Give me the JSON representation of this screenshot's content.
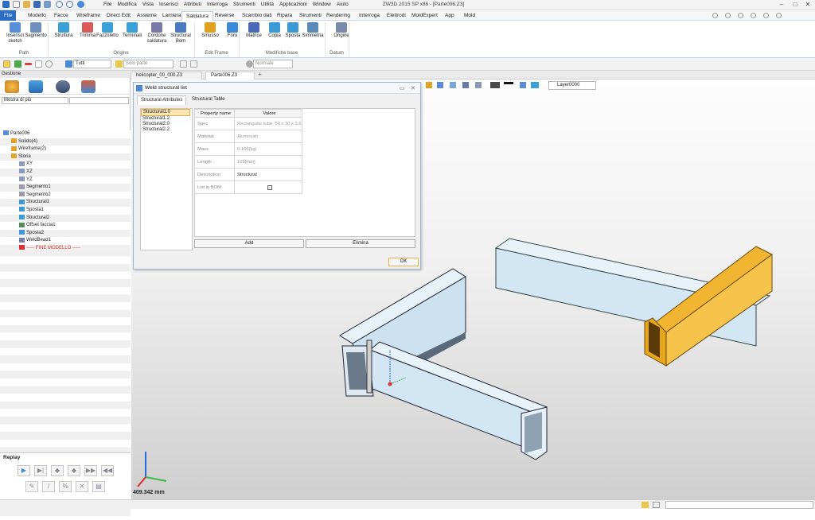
{
  "title_bar": {
    "menu": [
      "File",
      "Modifica",
      "Vista",
      "Inserisci",
      "Attributi",
      "Interroga",
      "Strumenti",
      "Utilità",
      "Applicazioni",
      "Window",
      "Aiuto"
    ],
    "title": "ZW3D 2015 SP x86 - [Parte006.Z3]"
  },
  "ribbon_tabs": [
    "File",
    "Modello",
    "Facce",
    "Wireframe",
    "Direct Edit",
    "Assieme",
    "Lamiera",
    "Saldatura",
    "Reverse",
    "Scambio dati",
    "Ripara",
    "Strumenti",
    "Rendering",
    "Interroga",
    "Elettrodi",
    "MoldExpert",
    "App",
    "Mold"
  ],
  "active_tab": "Saldatura",
  "ribbon": {
    "buttons": [
      {
        "label": "Inserisci\nsketch",
        "color": "#5a8fd8"
      },
      {
        "label": "Segmento",
        "color": "#6f8ebf"
      },
      {
        "label": "Struttura",
        "color": "#3aa0d8"
      },
      {
        "label": "Trimma",
        "color": "#d85a5a"
      },
      {
        "label": "Fazzoletto",
        "color": "#3aa0d8"
      },
      {
        "label": "Terminali",
        "color": "#3aa0d8"
      },
      {
        "label": "Cordone\nsaldatura",
        "color": "#7a7aa8"
      },
      {
        "label": "Structural\nBom",
        "color": "#4a7abf"
      },
      {
        "label": "Smusso",
        "color": "#e0a020"
      },
      {
        "label": "Foro",
        "color": "#3a8ad8"
      },
      {
        "label": "Matrice",
        "color": "#4a6ab8"
      },
      {
        "label": "Copia",
        "color": "#3a9ad8"
      },
      {
        "label": "Sposta",
        "color": "#3a9ad8"
      },
      {
        "label": "Simmetria",
        "color": "#5a8ab8"
      },
      {
        "label": "Origine",
        "color": "#7a8aa8"
      }
    ],
    "groups": [
      "Path",
      "Origine",
      "Edit Frame",
      "Modifiche base",
      "Datum"
    ]
  },
  "toolbar": {
    "filter_value": "Tutti",
    "part_value": "Solo parte",
    "normal_value": "Normale",
    "layer_value": "Layer0000"
  },
  "left_panel": {
    "header": "Gestione",
    "filter_value": "Mostra di più",
    "tree": [
      {
        "label": "Parte006",
        "indent": 0,
        "color": "#5b8ad0"
      },
      {
        "label": "Solido(4)",
        "indent": 1,
        "color": "#e2a22b"
      },
      {
        "label": "Wireframe(2)",
        "indent": 1,
        "color": "#e2a22b"
      },
      {
        "label": "Storia",
        "indent": 1,
        "color": "#e2a22b"
      },
      {
        "label": "XY",
        "indent": 2,
        "color": "#8a9ab8"
      },
      {
        "label": "XZ",
        "indent": 2,
        "color": "#8a9ab8"
      },
      {
        "label": "YZ",
        "indent": 2,
        "color": "#8a9ab8"
      },
      {
        "label": "Segmento1",
        "indent": 2,
        "color": "#9a9aa8"
      },
      {
        "label": "Segmento2",
        "indent": 2,
        "color": "#9a9aa8"
      },
      {
        "label": "Structural1",
        "indent": 2,
        "color": "#3a9ad8"
      },
      {
        "label": "Sposta1",
        "indent": 2,
        "color": "#3a9ad8"
      },
      {
        "label": "Structural2",
        "indent": 2,
        "color": "#3a9ad8"
      },
      {
        "label": "Offset faccia1",
        "indent": 2,
        "color": "#5a8a5a"
      },
      {
        "label": "Sposta2",
        "indent": 2,
        "color": "#3a9ad8"
      },
      {
        "label": "WeldBead1",
        "indent": 2,
        "color": "#7a7aa8"
      },
      {
        "label": "----- FINE MODELLO -----",
        "indent": 2,
        "color": "#d83030",
        "end": true
      }
    ],
    "replay_label": "Replay"
  },
  "doc_tabs": [
    "helicopter_00_000.Z3",
    "Parte006.Z3"
  ],
  "dialog": {
    "title": "Weld structural list",
    "tabs": [
      "Structural Attributes",
      "Structural Table"
    ],
    "list": [
      "Structural1.0",
      "Structural1.2",
      "Structural2.0",
      "Structural2.2"
    ],
    "headers": [
      "Property name",
      "Valore"
    ],
    "rows": [
      {
        "name": "Spec",
        "value": "Rectangular tube, 50 x 30 x 2.6"
      },
      {
        "name": "Material",
        "value": "Aluminum"
      },
      {
        "name": "Mass",
        "value": "0.166(kg)"
      },
      {
        "name": "Length",
        "value": "169[mm]"
      },
      {
        "name": "Description",
        "value": "Structural"
      },
      {
        "name": "List in BOM",
        "value": "checked"
      }
    ],
    "add_label": "Add",
    "delete_label": "Elimina",
    "ok_label": "OK"
  },
  "viewport": {
    "measurement": "409.342 mm"
  }
}
